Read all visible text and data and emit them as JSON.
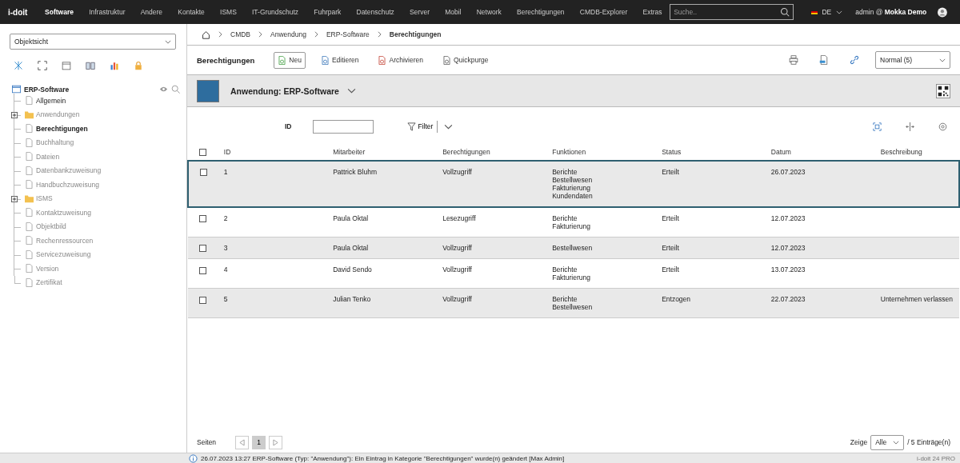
{
  "topbar": {
    "logo": "i-doit",
    "nav": [
      {
        "label": "Software",
        "selected": true
      },
      {
        "label": "Infrastruktur",
        "selected": false
      },
      {
        "label": "Andere",
        "selected": false
      },
      {
        "label": "Kontakte",
        "selected": false
      },
      {
        "label": "ISMS",
        "selected": false
      },
      {
        "label": "IT-Grundschutz",
        "selected": false
      },
      {
        "label": "Fuhrpark",
        "selected": false
      },
      {
        "label": "Datenschutz",
        "selected": false
      },
      {
        "label": "Server",
        "selected": false
      },
      {
        "label": "Mobil",
        "selected": false
      },
      {
        "label": "Network",
        "selected": false
      },
      {
        "label": "Berechtigungen",
        "selected": false
      },
      {
        "label": "CMDB-Explorer",
        "selected": false
      },
      {
        "label": "Extras",
        "selected": false
      }
    ],
    "search": {
      "placeholder": "Suche.."
    },
    "language": "DE",
    "user": {
      "name": "admin",
      "at": "@",
      "tenant": "Mokka Demo"
    }
  },
  "sidebar": {
    "view_select": "Objektsicht",
    "tree": {
      "label": "ERP-Software",
      "children": [
        {
          "label": "Allgemein",
          "kind": "file",
          "filled": true,
          "selected": false
        },
        {
          "label": "Anwendungen",
          "kind": "folder",
          "filled": false,
          "selected": false,
          "expanded": false
        },
        {
          "label": "Berechtigungen",
          "kind": "file",
          "filled": true,
          "selected": true
        },
        {
          "label": "Buchhaltung",
          "kind": "file",
          "filled": false,
          "selected": false
        },
        {
          "label": "Dateien",
          "kind": "file",
          "filled": false,
          "selected": false
        },
        {
          "label": "Datenbankzuweisung",
          "kind": "file",
          "filled": false,
          "selected": false
        },
        {
          "label": "Handbuchzuweisung",
          "kind": "file",
          "filled": false,
          "selected": false
        },
        {
          "label": "ISMS",
          "kind": "folder",
          "filled": false,
          "selected": false,
          "expanded": false
        },
        {
          "label": "Kontaktzuweisung",
          "kind": "file",
          "filled": false,
          "selected": false
        },
        {
          "label": "Objektbild",
          "kind": "file",
          "filled": false,
          "selected": false
        },
        {
          "label": "Rechenressourcen",
          "kind": "file",
          "filled": false,
          "selected": false
        },
        {
          "label": "Servicezuweisung",
          "kind": "file",
          "filled": false,
          "selected": false
        },
        {
          "label": "Version",
          "kind": "file",
          "filled": false,
          "selected": false
        },
        {
          "label": "Zertifikat",
          "kind": "file",
          "filled": false,
          "selected": false
        }
      ]
    }
  },
  "breadcrumb": [
    "CMDB",
    "Anwendung",
    "ERP-Software",
    "Berechtigungen"
  ],
  "toolbar": {
    "title": "Berechtigungen",
    "buttons": [
      {
        "label": "Neu",
        "kind": "new"
      },
      {
        "label": "Editieren",
        "kind": "edit"
      },
      {
        "label": "Archivieren",
        "kind": "archive"
      },
      {
        "label": "Quickpurge",
        "kind": "purge"
      }
    ],
    "status_select": "Normal (5)"
  },
  "object_header": {
    "title": "Anwendung: ERP-Software"
  },
  "filter": {
    "label": "ID",
    "button": "Filter"
  },
  "table": {
    "select_all_checked": false,
    "columns": [
      "ID",
      "Mitarbeiter",
      "Berechtigungen",
      "Funktionen",
      "Status",
      "Datum",
      "Beschreibung"
    ],
    "rows": [
      {
        "selected": true,
        "checked": false,
        "cells": [
          "1",
          "Pattrick Bluhm",
          "Vollzugriff",
          [
            "Berichte",
            "Bestellwesen",
            "Fakturierung",
            "Kundendaten"
          ],
          "Erteilt",
          "26.07.2023",
          ""
        ]
      },
      {
        "selected": false,
        "checked": false,
        "cells": [
          "2",
          "Paula Oktal",
          "Lesezugriff",
          [
            "Berichte",
            "Fakturierung"
          ],
          "Erteilt",
          "12.07.2023",
          ""
        ]
      },
      {
        "selected": false,
        "checked": false,
        "cells": [
          "3",
          "Paula Oktal",
          "Vollzugriff",
          [
            "Bestellwesen"
          ],
          "Erteilt",
          "12.07.2023",
          ""
        ]
      },
      {
        "selected": false,
        "checked": false,
        "cells": [
          "4",
          "David Sendo",
          "Vollzugriff",
          [
            "Berichte",
            "Fakturierung"
          ],
          "Erteilt",
          "13.07.2023",
          ""
        ]
      },
      {
        "selected": false,
        "checked": false,
        "cells": [
          "5",
          "Julian Tenko",
          "Vollzugriff",
          [
            "Berichte",
            "Bestellwesen"
          ],
          "Entzogen",
          "22.07.2023",
          "Unternehmen verlassen"
        ]
      }
    ]
  },
  "pager": {
    "label": "Seiten",
    "pages": [
      {
        "label": "1",
        "selected": true
      }
    ],
    "show_label": "Zeige",
    "show_select": "Alle",
    "count": "/ 5 Einträge(n)"
  },
  "status_bar": {
    "message": "26.07.2023 13:27 ERP-Software (Typ: \"Anwendung\"): Ein Eintrag in Kategorie \"Berechtigungen\" wurde(n) geändert [Max Admin]",
    "version": "i-doit 24 PRO"
  }
}
